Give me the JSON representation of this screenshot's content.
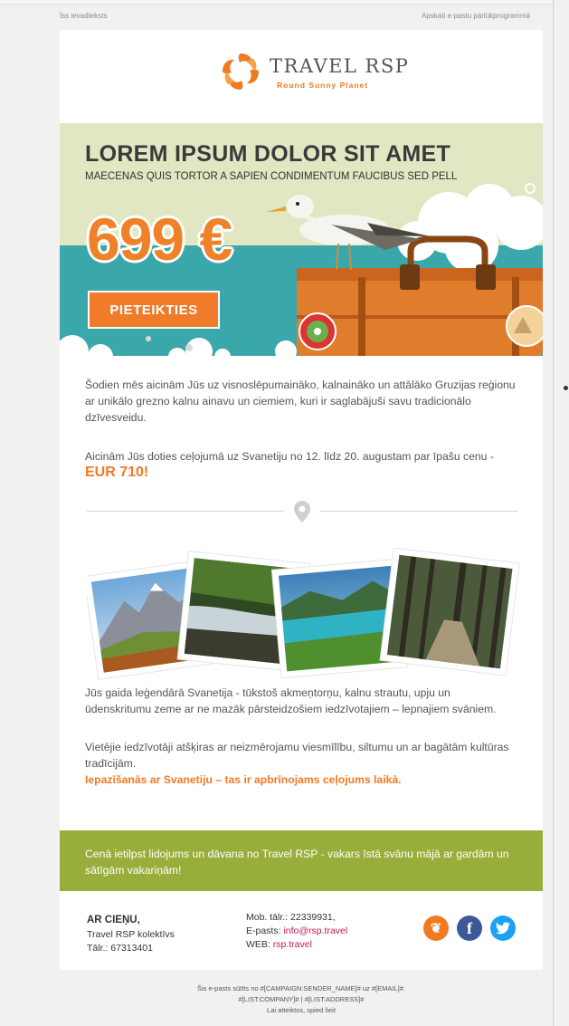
{
  "preheader": {
    "short_intro": "Īss ievadteksts",
    "browser_link": "Apskati e-pastu pārlūkprogrammā"
  },
  "logo": {
    "name": "TRAVEL RSP",
    "tagline": "Round Sunny Planet",
    "icon": "sun-swirl-logo"
  },
  "hero": {
    "title": "LOREM IPSUM DOLOR SIT AMET",
    "subtitle": "MAECENAS QUIS TORTOR A SAPIEN CONDIMENTUM FAUCIBUS SED PELL",
    "price": "699 €",
    "cta_label": "PIETEIKTIES"
  },
  "body": {
    "para1": "Šodien mēs aicinām Jūs uz visnoslēpumaināko, kalnaināko un attālāko Gruzijas reģionu ar unikālo grezno kalnu ainavu un ciemiem, kuri ir saglabājuši savu tradicionālo dzīvesveidu.",
    "para2": "Aicinām Jūs doties ceļojumā uz Svanetiju no 12. līdz 20. augustam par īpašu cenu -",
    "para2_price": "EUR 710!",
    "para3": "Jūs gaida leģendārā Svanetija - tūkstoš akmeņtorņu, kalnu strautu, upju un ūdenskritumu zeme ar ne mazāk pārsteidzošiem iedzīvotajiem – lepnajiem svāniem.",
    "para4": "Vietējie iedzīvotāji atšķiras ar neizmērojamu viesmīlību, siltumu un ar bagātām kultūras tradīcijām.",
    "para4_highlight": "Iepazīšanās ar Svanetiju – tas ir apbrīnojams ceļojums laikā."
  },
  "banner": {
    "text": "Cenā ietilpst lidojums un dāvana no Travel RSP - vakars īstā svānu mājā ar gardām un sātīgām vakariņām!"
  },
  "signature": {
    "title": "AR CIEŅU,",
    "team": "Travel RSP kolektīvs",
    "phone": "Tālr.: 67313401"
  },
  "contacts": {
    "mobile": "Mob. tālr.: 22339931,",
    "email_label": "E-pasts: ",
    "email": "info@rsp.travel",
    "web_label": "WEB: ",
    "web": "rsp.travel"
  },
  "social": [
    {
      "icon": "travel-rsp-icon",
      "color": "#f07a22",
      "glyph": "❦"
    },
    {
      "icon": "facebook-icon",
      "color": "#3b5998",
      "glyph": "f"
    },
    {
      "icon": "twitter-icon",
      "color": "#1da1f2",
      "glyph": "🐦"
    }
  ],
  "footer": {
    "line1": "Šis e-pasts sūtīts no #[CAMPAIGN:SENDER_NAME]# uz #[EMAIL]#.",
    "line2": "#[LIST:COMPANY]# | #[LIST:ADDRESS]#",
    "line3": "Lai atteiktos, spied šeit"
  },
  "colors": {
    "accent": "#f07a22",
    "green": "#98ae3b",
    "sea": "#3aa7ab"
  }
}
